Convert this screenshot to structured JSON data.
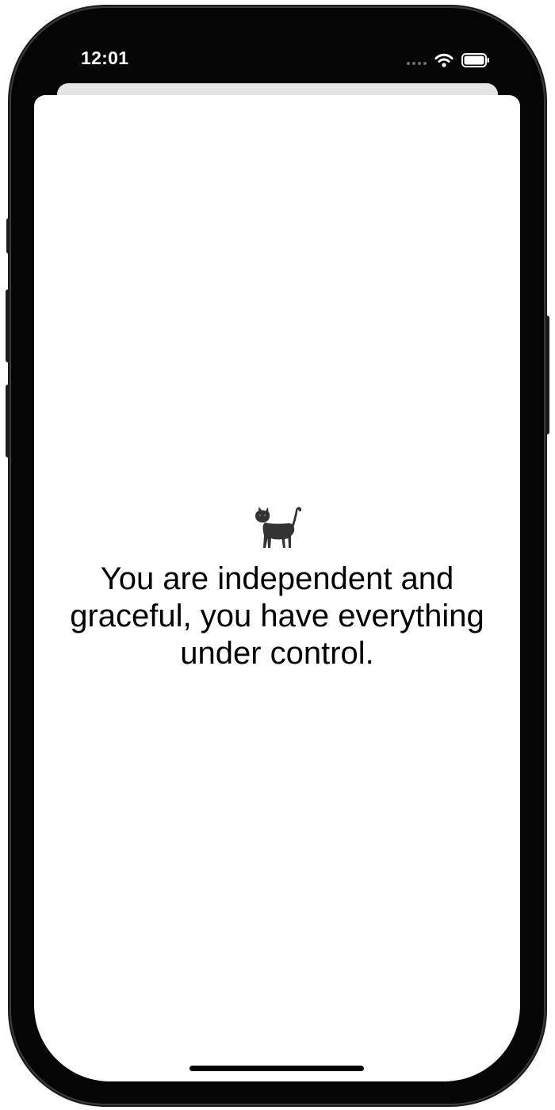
{
  "status_bar": {
    "time": "12:01",
    "icons": [
      "cellular-signal-icon",
      "wifi-icon",
      "battery-icon"
    ]
  },
  "screen": {
    "emoji_icon": "cat-icon",
    "message": "You are independent and graceful, you have everything under control."
  },
  "colors": {
    "device_frame": "#050505",
    "screen_background": "#ffffff",
    "sheet_backdrop": "#e5e5e5",
    "text": "#000000"
  }
}
